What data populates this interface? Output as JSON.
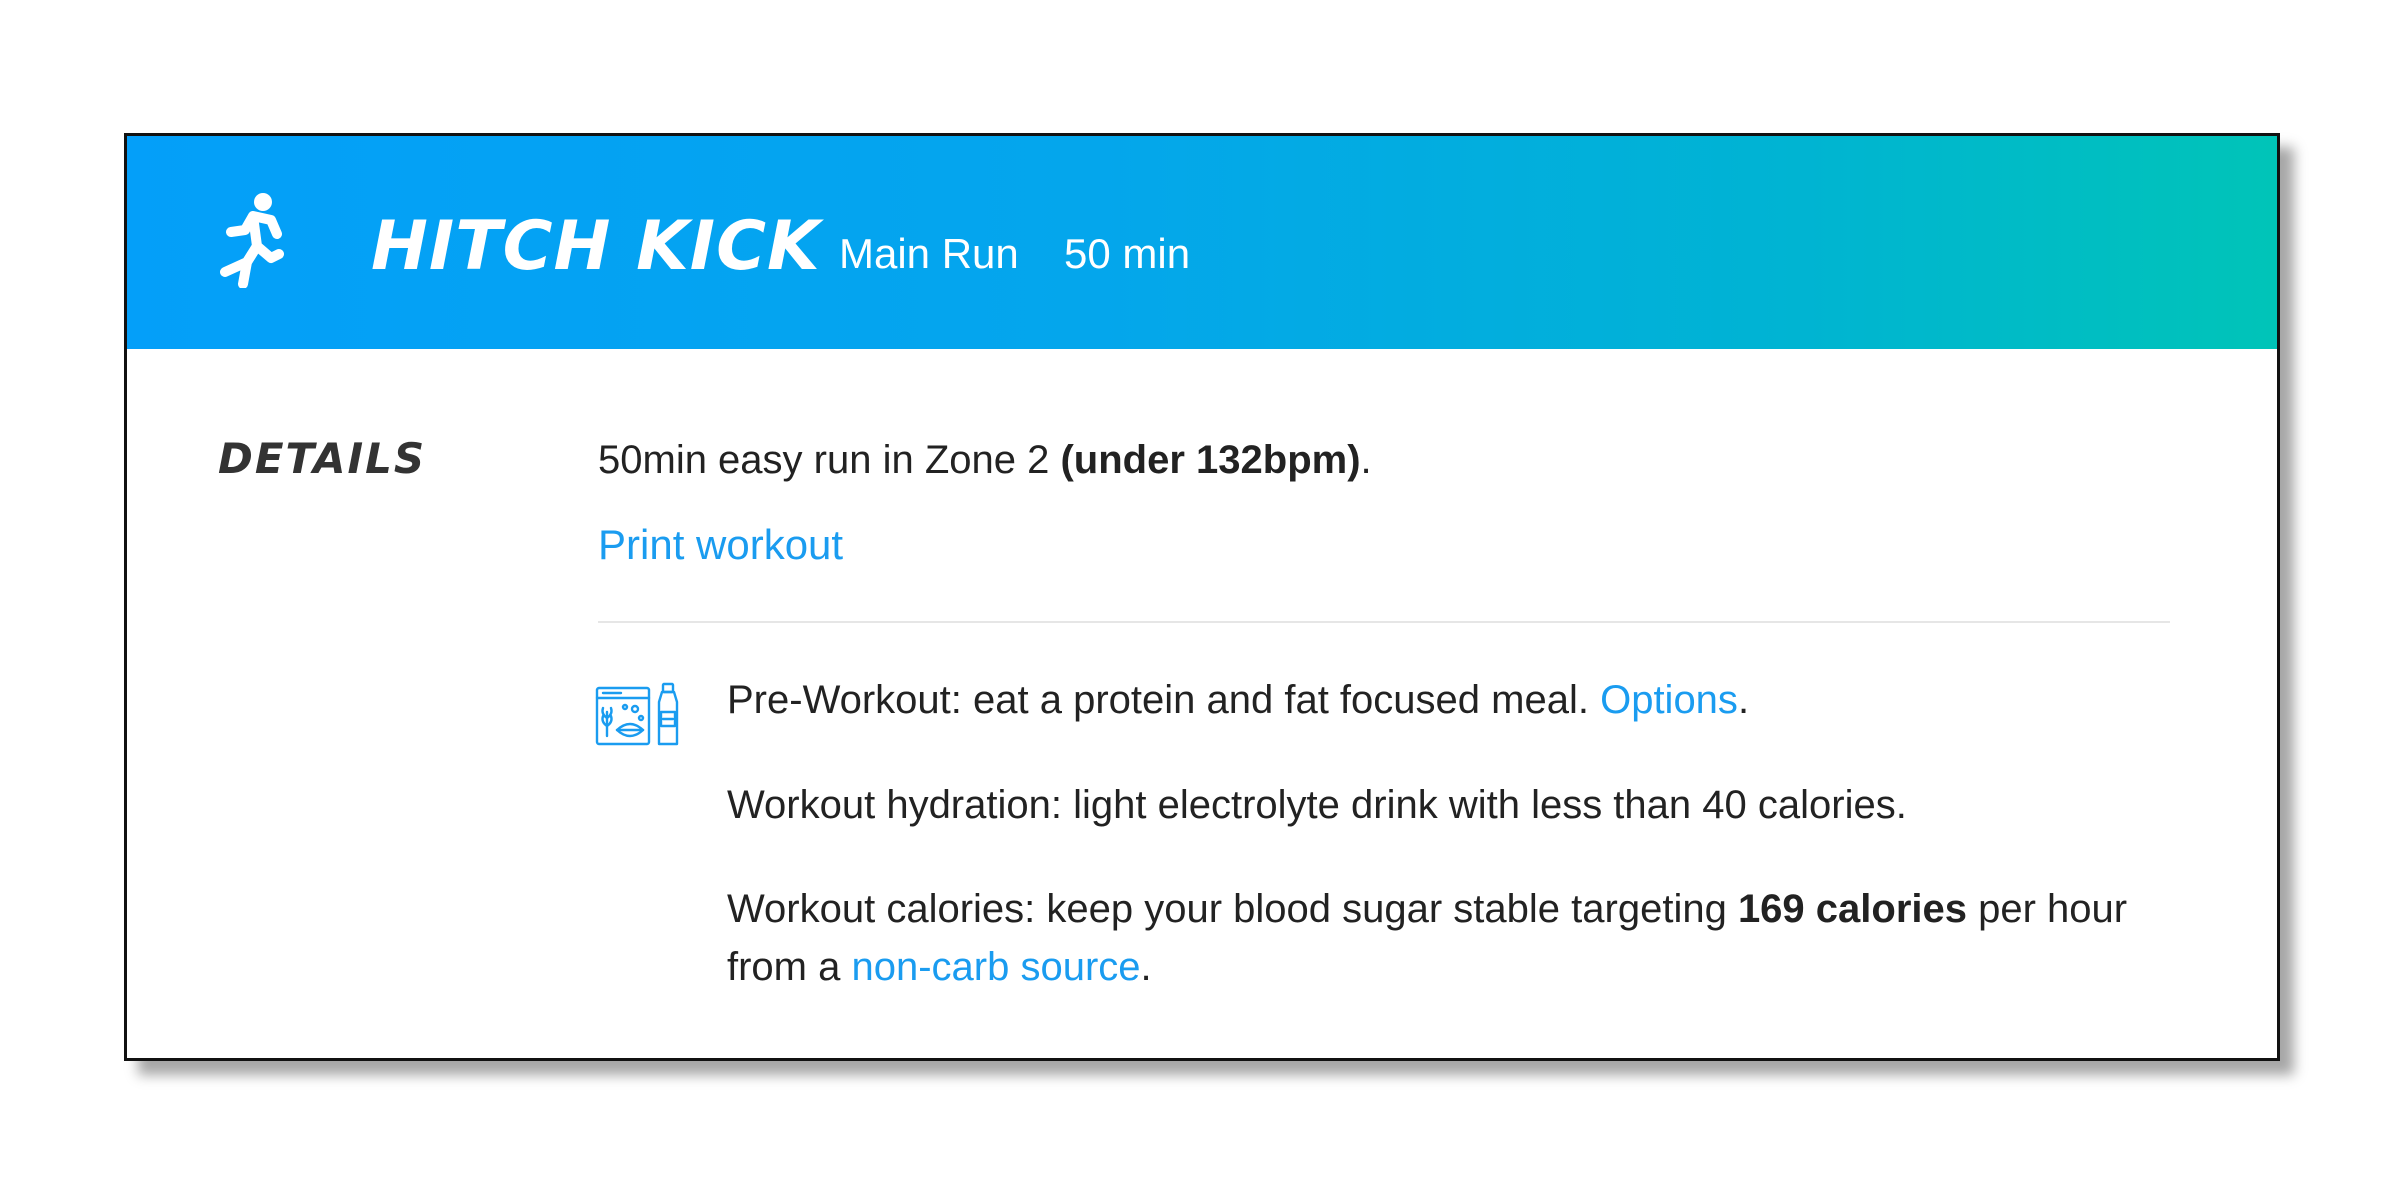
{
  "workout": {
    "title": "HITCH KICK",
    "type": "Main Run",
    "duration": "50 min",
    "icon": "runner-icon",
    "header_gradient": [
      "#049ff9",
      "#00c4b8"
    ]
  },
  "details": {
    "label": "DETAILS",
    "description_prefix": "50min easy run in Zone 2 ",
    "description_bold": "(under 132bpm)",
    "description_suffix": ".",
    "print_link": "Print workout"
  },
  "nutrition": {
    "icon": "food-and-drink-icon",
    "pre_workout_text": "Pre-Workout: eat a protein and fat focused meal. ",
    "pre_workout_link": "Options",
    "pre_workout_suffix": ".",
    "hydration_text": "Workout hydration: light electrolyte drink with less than 40 calories.",
    "calories_prefix": "Workout calories: keep your blood sugar stable targeting ",
    "calories_bold": "169 calories",
    "calories_middle": " per hour from a ",
    "calories_link": "non-carb source",
    "calories_suffix": "."
  },
  "colors": {
    "link": "#1a9cf0",
    "text": "#222222",
    "label": "#333333"
  }
}
